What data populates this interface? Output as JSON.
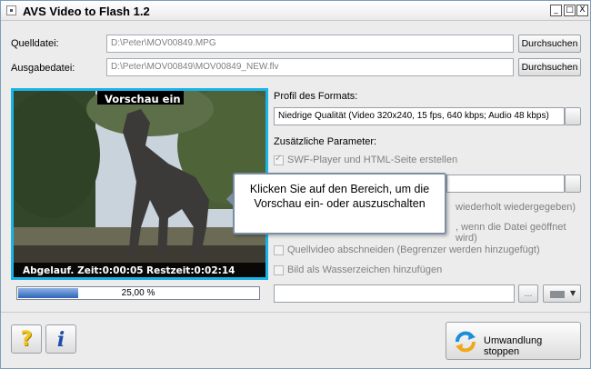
{
  "window": {
    "title": "AVS Video to Flash 1.2",
    "minimize_glyph": "_",
    "maximize_glyph": "□",
    "close_glyph": "X"
  },
  "source": {
    "label": "Quelldatei:",
    "value": "D:\\Peter\\MOV00849.MPG",
    "browse_label": "Durchsuchen"
  },
  "output": {
    "label": "Ausgabedatei:",
    "value": "D:\\Peter\\MOV00849\\MOV00849_NEW.flv",
    "browse_label": "Durchsuchen"
  },
  "preview": {
    "toggle_label": "Vorschau ein",
    "elapsed": "Abgelauf. Zeit:0:00:05",
    "remaining": "Restzeit:0:02:14",
    "frame_colors": {
      "border": "#19b3e8",
      "sky": "#c9d3dc",
      "foliage": "#3f5431",
      "statue": "#3b3a38"
    }
  },
  "progress": {
    "text": "25,00 %",
    "fraction": 0.25
  },
  "format": {
    "profile_label": "Profil des Formats:",
    "profile_value": "Niedrige Qualität (Video 320x240, 15 fps, 640 kbps; Audio 48 kbps)",
    "extra_params_label": "Zusätzliche Parameter:",
    "swf_option": "SWF-Player und HTML-Seite erstellen",
    "loop_partial": "wiederholt wiedergegeben)",
    "open_partial": ", wenn die Datei geöffnet wird)",
    "trim_option": "Quellvideo abschneiden (Begrenzer werden hinzugefügt)",
    "watermark_option": "Bild als Wasserzeichen hinzufügen",
    "image_browse": "..."
  },
  "tooltip": {
    "text": "Klicken Sie auf den Bereich, um die Vorschau ein- oder auszuschalten"
  },
  "footer": {
    "help_glyph": "?",
    "info_glyph": "i",
    "stop_label": "Umwandlung stoppen"
  },
  "colors": {
    "accent": "#19b3e8",
    "progress": "#2e64b8",
    "help_yellow": "#f2c51b",
    "info_blue": "#1f4fa8"
  }
}
